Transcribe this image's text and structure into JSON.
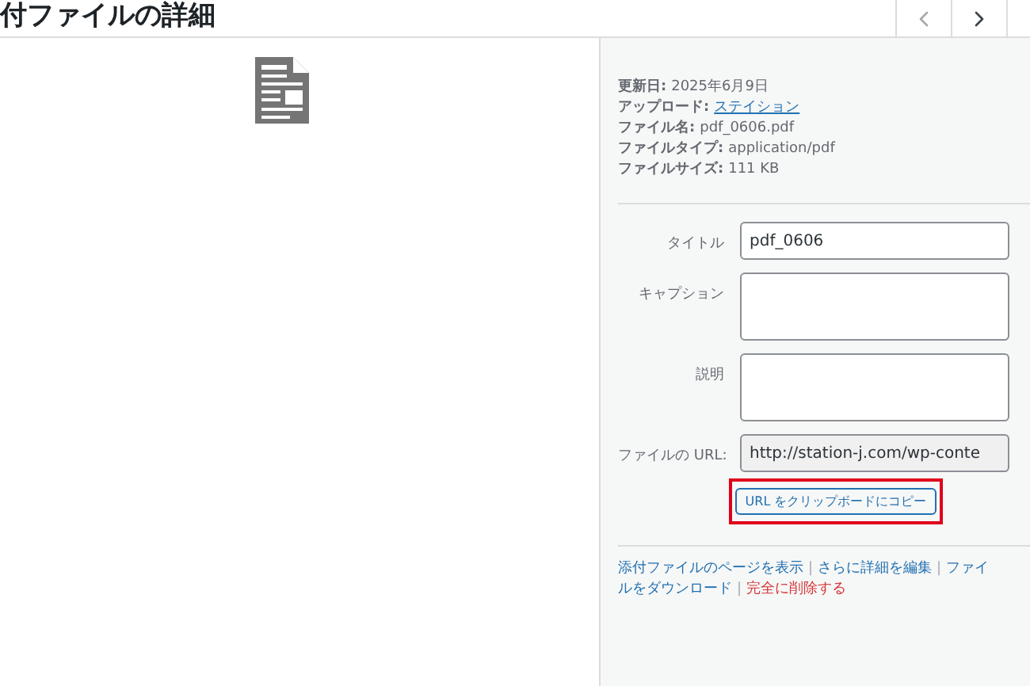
{
  "header": {
    "title": "付ファイルの詳細"
  },
  "details": [
    {
      "label": "更新日:",
      "value": "2025年6月9日",
      "kind": "text"
    },
    {
      "label": "アップロード:",
      "value": "ステイション",
      "kind": "link"
    },
    {
      "label": "ファイル名:",
      "value": "pdf_0606.pdf",
      "kind": "text"
    },
    {
      "label": "ファイルタイプ:",
      "value": "application/pdf",
      "kind": "text"
    },
    {
      "label": "ファイルサイズ:",
      "value": "111 KB",
      "kind": "text"
    }
  ],
  "fields": [
    {
      "label": "タイトル",
      "value": "pdf_0606",
      "kind": "input"
    },
    {
      "label": "キャプション",
      "kind": "textarea"
    },
    {
      "label": "説明",
      "kind": "textarea"
    },
    {
      "label": "ファイルの URL:",
      "value": "http://station-j.com/wp-conte",
      "kind": "readonly"
    }
  ],
  "copy_button": {
    "label": "URL をクリップボードにコピー",
    "highlighted": true
  },
  "action_separator": "|",
  "actions": [
    [
      {
        "text": "添付ファイルのページを表示",
        "kind": "link"
      },
      {
        "text": "さらに詳細を編集",
        "kind": "link"
      },
      {
        "text": "ファイ",
        "kind": "link"
      }
    ],
    [
      {
        "text": "ルをダウンロード",
        "kind": "link"
      },
      {
        "text": "完全に削除する",
        "kind": "danger"
      }
    ]
  ]
}
